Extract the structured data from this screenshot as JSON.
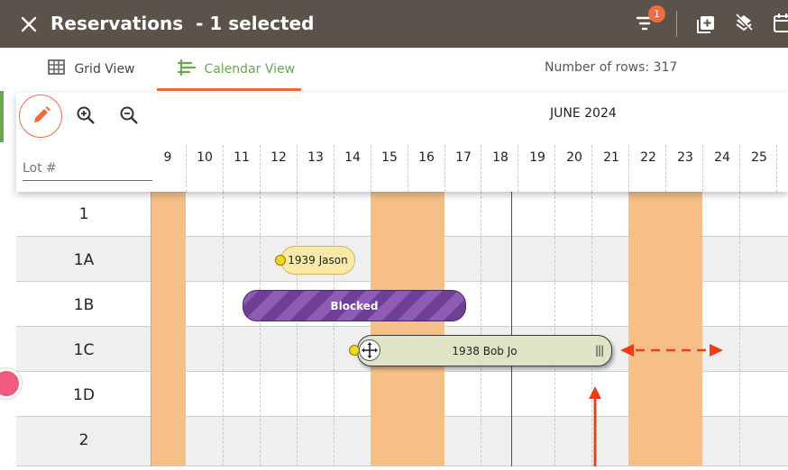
{
  "header": {
    "title": "Reservations",
    "selection": "- 1 selected",
    "filter_badge": "1",
    "close_icon": "close-icon",
    "icons": [
      "filter-icon",
      "add-box-icon",
      "layers-off-icon",
      "calendar-icon"
    ]
  },
  "tabs": [
    {
      "label": "Grid View",
      "icon": "grid-icon",
      "active": false
    },
    {
      "label": "Calendar View",
      "icon": "calendar-view-icon",
      "active": true
    }
  ],
  "row_count": "Number of rows: 317",
  "calendar": {
    "month": "JUNE 2024",
    "lot_label": "Lot #",
    "days": [
      "9",
      "10",
      "11",
      "12",
      "13",
      "14",
      "15",
      "16",
      "17",
      "18",
      "19",
      "20",
      "21",
      "22",
      "23",
      "24",
      "25"
    ],
    "rows": [
      "1",
      "1A",
      "1B",
      "1C",
      "1D",
      "2"
    ],
    "reservations": [
      {
        "label": "1939 Jason",
        "row": "1A"
      },
      {
        "label": "Blocked",
        "row": "1B"
      },
      {
        "label": "1938 Bob Jo",
        "row": "1C"
      }
    ],
    "grip": "|||"
  },
  "colors": {
    "header_bg": "#5b5249",
    "accent": "#f26a3d",
    "active_tab": "#6aa84f",
    "weekend": "#f6bf88",
    "today_line": "#dd1111",
    "blocked": "#7d4ca6",
    "annotation_arrow": "#f03c14"
  }
}
